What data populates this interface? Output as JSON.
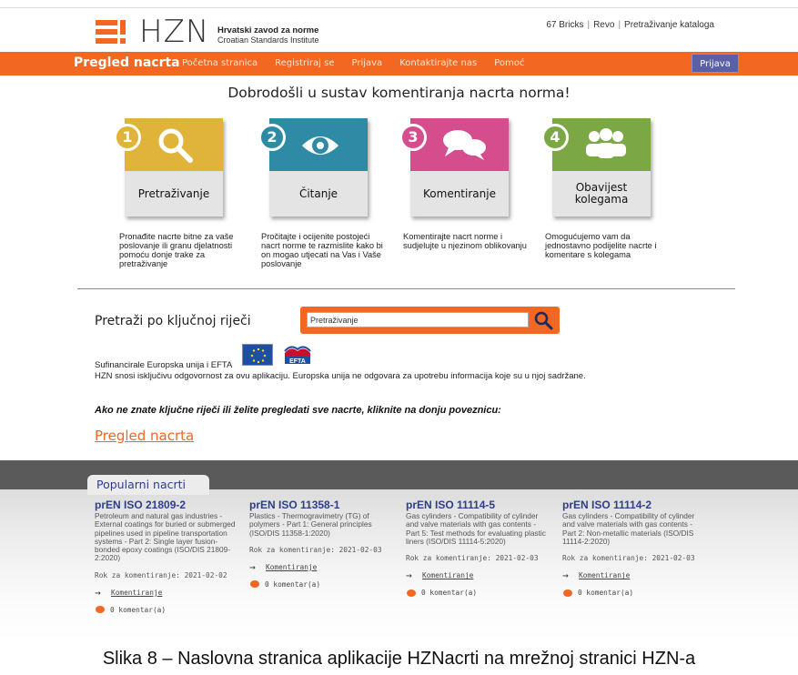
{
  "header": {
    "logo_text": "HZN",
    "institute_hr": "Hrvatski zavod za norme",
    "institute_en": "Croatian Standards Institute",
    "toplinks": [
      "67 Bricks",
      "Revo",
      "Pretraživanje kataloga"
    ]
  },
  "nav": {
    "brand": "Pregled nacrta",
    "items": [
      "Početna stranica",
      "Registriraj se",
      "Prijava",
      "Kontaktirajte nas",
      "Pomoć"
    ],
    "login_button": "Prijava"
  },
  "welcome": "Dobrodošli u sustav komentiranja nacrta norma!",
  "steps": [
    {
      "num": "1",
      "label": "Pretraživanje",
      "icon": "search-icon",
      "color": "#e0b33a",
      "desc": "Pronađite nacrte bitne za vaše poslovanje ili granu djelatnosti pomoću donje trake za pretraživanje"
    },
    {
      "num": "2",
      "label": "Čitanje",
      "icon": "eye-icon",
      "color": "#2f8aa6",
      "desc": "Pročitajte i ocijenite postojeći nacrt norme te razmislite kako bi on mogao utjecati na Vas i Vaše poslovanje"
    },
    {
      "num": "3",
      "label": "Komentiranje",
      "icon": "speech-bubbles-icon",
      "color": "#d64d8d",
      "desc": "Komentirajte nacrt norme i sudjelujte u njezinom oblikovanju"
    },
    {
      "num": "4",
      "label": "Obavijest kolegama",
      "icon": "people-icon",
      "color": "#7ba745",
      "desc": "Omogućujemo vam da jednostavno podijelite nacrte i komentare s kolegama"
    }
  ],
  "search": {
    "label": "Pretraži po ključnoj riječi",
    "value": "Pretraživanje"
  },
  "eu": {
    "funding": "Sufinancirale Europska unija i EFTA",
    "disclaimer": "HZN snosi isključivu odgovornost za ovu aplikaciju. Europska unija ne odgovara za upotrebu informacija koje su u njoj sadržane.",
    "efta_label": "EFTA"
  },
  "browse_note": "Ako ne znate ključne riječi ili želite pregledati sve nacrte, kliknite na donju poveznicu:",
  "browse_link": "Pregled nacrta",
  "popular": {
    "tab": "Popularni nacrti",
    "items": [
      {
        "title": "prEN ISO 21809-2",
        "desc": "Petroleum and natural gas industries - External coatings for buried or submerged pipelines used in pipeline transportation systems - Part 2: Single layer fusion-bonded epoxy coatings (ISO/DIS 21809-2:2020)",
        "deadline": "Rok za komentiranje: 2021-02-02",
        "comment_link": "Komentiranje",
        "comments": "0 komentar(a)"
      },
      {
        "title": "prEN ISO 11358-1",
        "desc": "Plastics - Thermogravimetry (TG) of polymers - Part 1: General principles (ISO/DIS 11358-1:2020)",
        "deadline": "Rok za komentiranje: 2021-02-03",
        "comment_link": "Komentiranje",
        "comments": "0 komentar(a)"
      },
      {
        "title": "prEN ISO 11114-5",
        "desc": "Gas cylinders - Compatibility of cylinder and valve materials with gas contents - Part 5: Test methods for evaluating plastic liners (ISO/DIS 11114-5:2020)",
        "deadline": "Rok za komentiranje: 2021-02-03",
        "comment_link": "Komentiranje",
        "comments": "0 komentar(a)"
      },
      {
        "title": "prEN ISO 11114-2",
        "desc": "Gas cylinders - Compatibility of cylinder and valve materials with gas contents - Part 2: Non-metallic materials (ISO/DIS 11114-2:2020)",
        "deadline": "Rok za komentiranje: 2021-02-03",
        "comment_link": "Komentiranje",
        "comments": "0 komentar(a)"
      }
    ]
  },
  "caption": "Slika 8 – Naslovna stranica aplikacije HZNacrti na mrežnoj stranici HZN-a"
}
